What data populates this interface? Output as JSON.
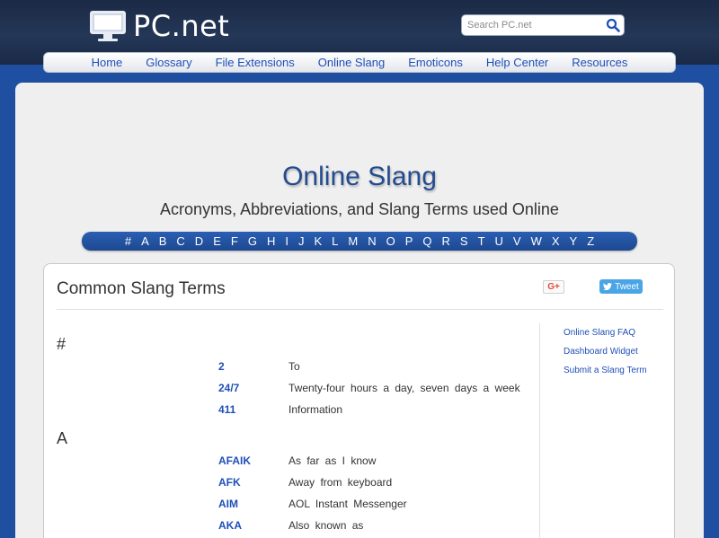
{
  "header": {
    "logo_text": "PC.net",
    "search_placeholder": "Search PC.net"
  },
  "nav": {
    "items": [
      "Home",
      "Glossary",
      "File Extensions",
      "Online Slang",
      "Emoticons",
      "Help Center",
      "Resources"
    ]
  },
  "page": {
    "title": "Online Slang",
    "subtitle": "Acronyms, Abbreviations, and Slang Terms used Online"
  },
  "alphabet": [
    "#",
    "A",
    "B",
    "C",
    "D",
    "E",
    "F",
    "G",
    "H",
    "I",
    "J",
    "K",
    "L",
    "M",
    "N",
    "O",
    "P",
    "Q",
    "R",
    "S",
    "T",
    "U",
    "V",
    "W",
    "X",
    "Y",
    "Z"
  ],
  "content": {
    "title": "Common Slang Terms",
    "gplus_label": "G+",
    "tweet_label": "Tweet",
    "side_links": [
      "Online Slang FAQ",
      "Dashboard Widget",
      "Submit a Slang Term"
    ],
    "sections": [
      {
        "heading": "#",
        "terms": [
          {
            "abbr": "2",
            "def": "To"
          },
          {
            "abbr": "24/7",
            "def": "Twenty-four hours a day, seven days a week"
          },
          {
            "abbr": "411",
            "def": "Information"
          }
        ]
      },
      {
        "heading": "A",
        "terms": [
          {
            "abbr": "AFAIK",
            "def": "As far as I know"
          },
          {
            "abbr": "AFK",
            "def": "Away from keyboard"
          },
          {
            "abbr": "AIM",
            "def": "AOL Instant Messenger"
          },
          {
            "abbr": "AKA",
            "def": "Also known as"
          }
        ]
      }
    ]
  },
  "colors": {
    "background": "#1f4fa0",
    "header": "#243757",
    "link": "#1f4fb8",
    "title": "#234c8f"
  }
}
